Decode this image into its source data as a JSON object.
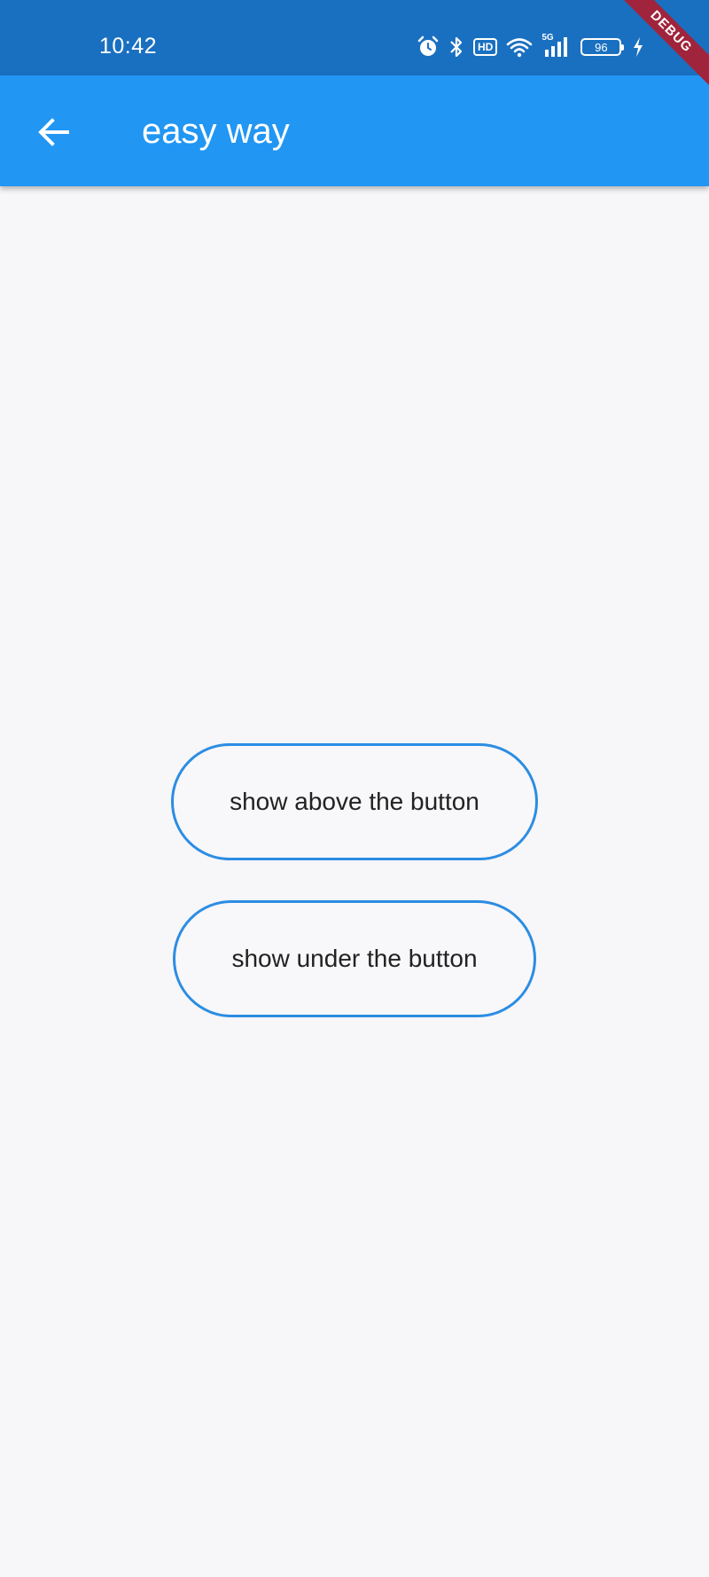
{
  "status_bar": {
    "time": "10:42",
    "icons": [
      "alarm-icon",
      "bluetooth-icon",
      "hd-icon",
      "wifi-icon",
      "5g-signal-icon",
      "battery-icon",
      "charging-icon"
    ],
    "hd_label": "HD",
    "network_label": "5G",
    "battery_level": "96"
  },
  "debug_banner": "DEBUG",
  "app_bar": {
    "back_icon": "arrow-back-icon",
    "title": "easy way",
    "color": "#2196f3"
  },
  "buttons": {
    "above_label": "show above the button",
    "under_label": "show under the button",
    "border_color": "#2b8de3"
  }
}
